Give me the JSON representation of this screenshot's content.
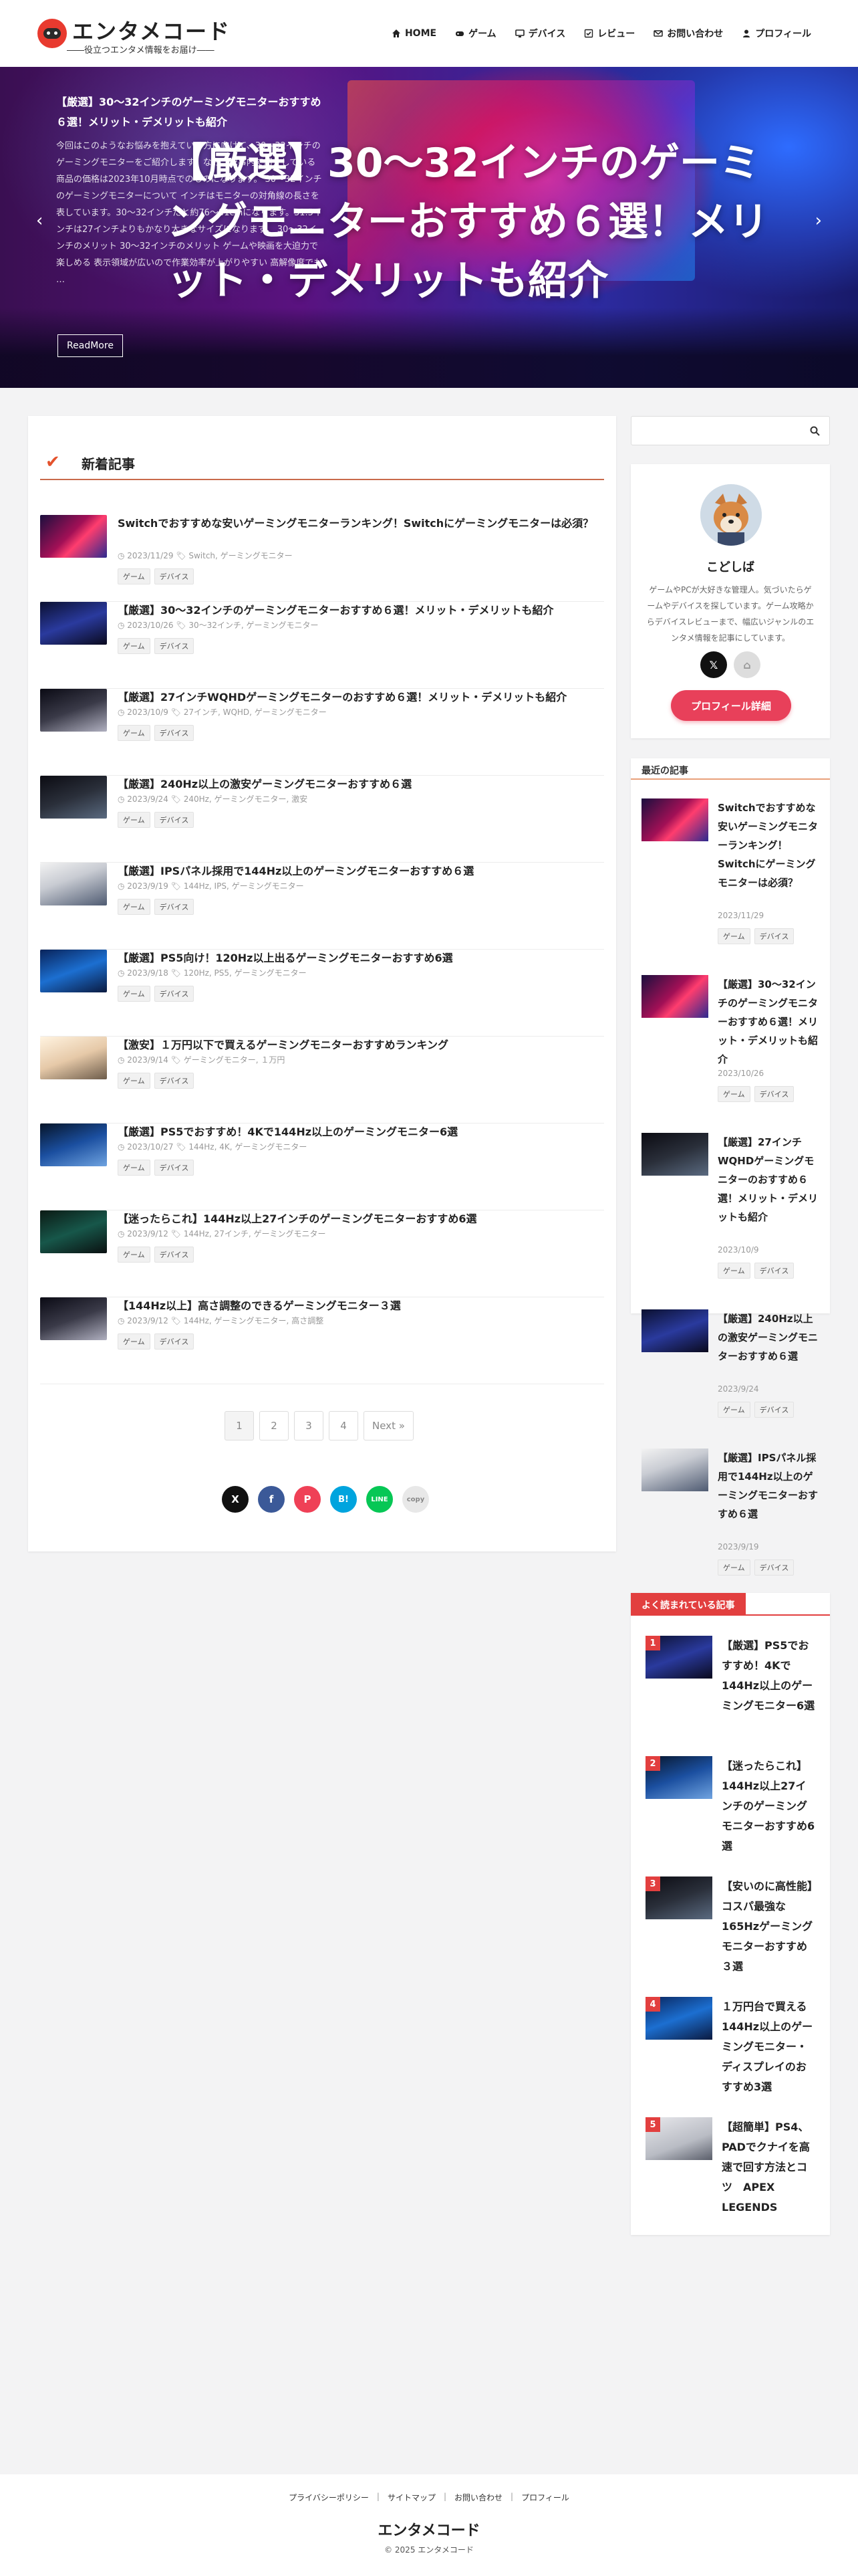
{
  "header": {
    "logo_text": "エンタメコード",
    "tagline": "――役立つエンタメ情報をお届け――",
    "nav": [
      "HOME",
      "ゲーム",
      "デバイス",
      "レビュー",
      "お問い合わせ",
      "プロフィール"
    ]
  },
  "hero": {
    "title": "【厳選】30～32インチのゲーミングモニターおすすめ６選！メリット・デメリットも紹介",
    "big_text": "【厳選】30～32インチのゲーミングモニターおすすめ６選！メリット・デメリットも紹介",
    "excerpt": "今回はこのようなお悩みを抱えている方に向けて、30～32インチのゲーミングモニターをご紹介します。なお、記事内で紹介している商品の価格は2023年10月時点でのものになります。 30～32インチのゲーミングモニターについて インチはモニターの対角線の長さを表しています。30～32インチだと約76～81cmになります。31.5インチは27インチよりもかなり大きなサイズになります。 30～32インチのメリット 30～32インチのメリット ゲームや映画を大迫力で楽しめる 表示領域が広いので作業効率が上がりやすい 高解像度でも …",
    "button": "ReadMore",
    "prev": "‹",
    "next": "›"
  },
  "main": {
    "section_title": "新着記事",
    "articles": [
      {
        "title": "Switchでおすすめな安いゲーミングモニターランキング！Switchにゲーミングモニターは必須？",
        "date": "2023/11/29",
        "tags_text": "Switch, ゲーミングモニター",
        "cats": [
          "ゲーム",
          "デバイス"
        ]
      },
      {
        "title": "【厳選】30～32インチのゲーミングモニターおすすめ６選！メリット・デメリットも紹介",
        "date": "2023/10/26",
        "tags_text": "30～32インチ, ゲーミングモニター",
        "cats": [
          "ゲーム",
          "デバイス"
        ]
      },
      {
        "title": "【厳選】27インチWQHDゲーミングモニターのおすすめ６選！メリット・デメリットも紹介",
        "date": "2023/10/9",
        "tags_text": "27インチ, WQHD, ゲーミングモニター",
        "cats": [
          "ゲーム",
          "デバイス"
        ]
      },
      {
        "title": "【厳選】240Hz以上の激安ゲーミングモニターおすすめ６選",
        "date": "2023/9/24",
        "tags_text": "240Hz, ゲーミングモニター, 激安",
        "cats": [
          "ゲーム",
          "デバイス"
        ]
      },
      {
        "title": "【厳選】IPSパネル採用で144Hz以上のゲーミングモニターおすすめ６選",
        "date": "2023/9/19",
        "tags_text": "144Hz, IPS, ゲーミングモニター",
        "cats": [
          "ゲーム",
          "デバイス"
        ]
      },
      {
        "title": "【厳選】PS5向け！120Hz以上出るゲーミングモニターおすすめ6選",
        "date": "2023/9/18",
        "tags_text": "120Hz, PS5, ゲーミングモニター",
        "cats": [
          "ゲーム",
          "デバイス"
        ]
      },
      {
        "title": "【激安】１万円以下で買えるゲーミングモニターおすすめランキング",
        "date": "2023/9/14",
        "tags_text": "ゲーミングモニター, １万円",
        "cats": [
          "ゲーム",
          "デバイス"
        ]
      },
      {
        "title": "【厳選】PS5でおすすめ！4Kで144Hz以上のゲーミングモニター6選",
        "date": "2023/10/27",
        "tags_text": "144Hz, 4K, ゲーミングモニター",
        "cats": [
          "ゲーム",
          "デバイス"
        ]
      },
      {
        "title": "【迷ったらこれ】144Hz以上27インチのゲーミングモニターおすすめ6選",
        "date": "2023/9/12",
        "tags_text": "144Hz, 27インチ, ゲーミングモニター",
        "cats": [
          "ゲーム",
          "デバイス"
        ]
      },
      {
        "title": "【144Hz以上】高さ調整のできるゲーミングモニター３選",
        "date": "2023/9/12",
        "tags_text": "144Hz, ゲーミングモニター, 高さ調整",
        "cats": [
          "ゲーム",
          "デバイス"
        ]
      }
    ],
    "pagination": [
      "1",
      "2",
      "3",
      "4",
      "Next »"
    ],
    "share": [
      "X",
      "f",
      "P",
      "B!",
      "LINE",
      "copy"
    ]
  },
  "sidebar": {
    "profile": {
      "name": "こどしば",
      "desc": "ゲームやPCが大好きな管理人。気づいたらゲームやデバイスを探しています。ゲーム攻略からデバイスレビューまで、幅広いジャンルのエンタメ情報を記事にしています。",
      "button": "プロフィール詳細"
    },
    "recent_title": "最近の記事",
    "recent": [
      {
        "title": "Switchでおすすめな安いゲーミングモニターランキング！Switchにゲーミングモニターは必須？",
        "date": "2023/11/29",
        "cats": [
          "ゲーム",
          "デバイス"
        ]
      },
      {
        "title": "【厳選】30～32インチのゲーミングモニターおすすめ６選！メリット・デメリットも紹介",
        "date": "2023/10/26",
        "cats": [
          "ゲーム",
          "デバイス"
        ]
      },
      {
        "title": "【厳選】27インチWQHDゲーミングモニターのおすすめ６選！メリット・デメリットも紹介",
        "date": "2023/10/9",
        "cats": [
          "ゲーム",
          "デバイス"
        ]
      },
      {
        "title": "【厳選】240Hz以上の激安ゲーミングモニターおすすめ６選",
        "date": "2023/9/24",
        "cats": [
          "ゲーム",
          "デバイス"
        ]
      },
      {
        "title": "【厳選】IPSパネル採用で144Hz以上のゲーミングモニターおすすめ６選",
        "date": "2023/9/19",
        "cats": [
          "ゲーム",
          "デバイス"
        ]
      }
    ],
    "popular_title": "よく読まれている記事",
    "popular": [
      {
        "rank": "1",
        "title": "【厳選】PS5でおすすめ！4Kで144Hz以上のゲーミングモニター6選"
      },
      {
        "rank": "2",
        "title": "【迷ったらこれ】144Hz以上27インチのゲーミングモニターおすすめ6選"
      },
      {
        "rank": "3",
        "title": "【安いのに高性能】コスパ最強な165Hzゲーミングモニターおすすめ３選"
      },
      {
        "rank": "4",
        "title": "１万円台で買える144Hz以上のゲーミングモニター・ディスプレイのおすすめ3選"
      },
      {
        "rank": "5",
        "title": "【超簡単】PS4、PADでクナイを高速で回す方法とコツ　APEX LEGENDS"
      }
    ]
  },
  "footer": {
    "links": [
      "プライバシーポリシー",
      "サイトマップ",
      "お問い合わせ",
      "プロフィール"
    ],
    "logo": "エンタメコード",
    "copyright": "© 2025 エンタメコード"
  },
  "colors": {
    "accent": "#e8405a",
    "rank": "#e23f3f",
    "section_line": "#c96a4b"
  }
}
